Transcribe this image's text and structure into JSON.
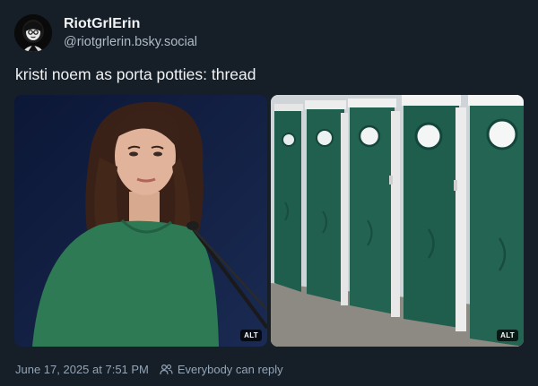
{
  "author": {
    "display_name": "RiotGrlErin",
    "handle": "@riotgrlerin.bsky.social",
    "avatar_icon": "avatar-illustration"
  },
  "post": {
    "text": "kristi noem as porta potties: thread"
  },
  "images": [
    {
      "alt_label": "ALT",
      "subject": "woman in green dress at microphone"
    },
    {
      "alt_label": "ALT",
      "subject": "row of green portable toilets"
    }
  ],
  "meta": {
    "timestamp": "June 17, 2025 at 7:51 PM",
    "reply_setting": "Everybody can reply",
    "reply_icon": "people-icon"
  },
  "colors": {
    "background": "#161e27",
    "text": "#f1f3f5",
    "muted": "#93a5b7",
    "porta_green": "#1f5a4a"
  }
}
